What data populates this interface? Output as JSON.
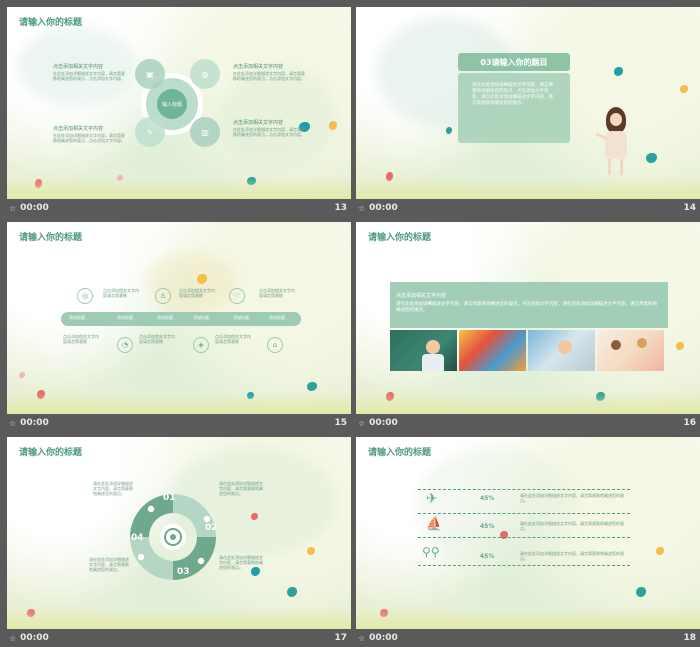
{
  "colors": {
    "accent": "#4f9a7d",
    "teal": "#2aa39a",
    "mint": "#9cc9b3",
    "bar_bg": "#5a5a5a"
  },
  "icons": {
    "star": "star-icon"
  },
  "slides": [
    {
      "title": "请输入你的标题",
      "time": "00:00",
      "num": "13",
      "center_label": "输入标题",
      "blocks": [
        {
          "head": "点击添加相关文字内容",
          "body": "在此处添加详细描述文字内容，请言简意赅地阐述您的观点，点击添加文字内容。"
        },
        {
          "head": "点击添加相关文字内容",
          "body": "在此处添加详细描述文字内容，请言简意赅地阐述您的观点，点击添加文字内容。"
        },
        {
          "head": "点击添加相关文字内容",
          "body": "在此处添加详细描述文字内容，请言简意赅地阐述您的观点，点击添加文字内容。"
        },
        {
          "head": "点击添加相关文字内容",
          "body": "在此处添加详细描述文字内容，请言简意赅地阐述您的观点，点击添加文字内容。"
        }
      ]
    },
    {
      "title": "03请输入你的题目",
      "time": "00:00",
      "num": "14",
      "body": "请在此处添加详细描述文字内容，请言简意赅地阐述您的观点，点击添加文字内容，请在此处添加详细描述文字内容，请言简意赅地阐述您的观点。"
    },
    {
      "title": "请输入你的标题",
      "time": "00:00",
      "num": "15",
      "step_label": "添加标题",
      "step_text": "点击添加相关文字内容请言简意赅"
    },
    {
      "title": "请输入你的标题",
      "time": "00:00",
      "num": "16",
      "band_head": "点击添加相关文字内容",
      "band_text": "请在此处添加详细描述文字内容，请言简意赅地阐述您的观点，点击添加文字内容，请在此处添加详细描述文字内容，请言简意赅地阐述您的观点。"
    },
    {
      "title": "请输入你的标题",
      "time": "00:00",
      "num": "17",
      "segments": [
        "01",
        "02",
        "03",
        "04"
      ],
      "text": "请在此处添加详细描述文字内容，请言简意赅地阐述您的观点。"
    },
    {
      "title": "请输入你的标题",
      "time": "00:00",
      "num": "18",
      "rows": [
        {
          "pct": "45%",
          "icon": "airplane-icon"
        },
        {
          "pct": "45%",
          "icon": "sailboat-icon"
        },
        {
          "pct": "45%",
          "icon": "bicycle-icon"
        }
      ],
      "row_text": "请在此处添加详细描述文字内容，请言简意赅地阐述您的观点。"
    }
  ]
}
